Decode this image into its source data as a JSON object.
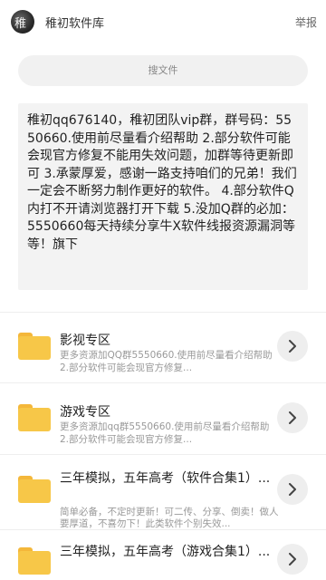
{
  "header": {
    "logo_glyph": "稚",
    "title": "稚初软件库",
    "report_label": "举报"
  },
  "search": {
    "placeholder": "搜文件"
  },
  "notice": {
    "text": "稚初qq676140，稚初团队vip群，群号码：5550660.使用前尽量看介绍帮助 2.部分软件可能会现官方修复不能用失效问题，加群等待更新即可 3.承蒙厚爱，感谢一路支持咱们的兄弟！我们一定会不断努力制作更好的软件。 4.部分软件Q内打不开请浏览器打开下载 5.没加Q群的必加：5550660每天持续分享牛X软件线报资源漏洞等等！旗下"
  },
  "folders": [
    {
      "title": "影视专区",
      "desc": "更多资源加QQ群5550660.使用前尽量看介绍帮助 2.部分软件可能会现官方修复..."
    },
    {
      "title": "游戏专区",
      "desc": "更多资源加qq群5550660.使用前尽量看介绍帮助 2.部分软件可能会现官方修复..."
    },
    {
      "title": "三年模拟，五年高考（软件合集1）...",
      "desc": "简单必备，不定时更新！可二传、分享、倒卖！做人要厚道，不喜勿下！此类软件个别失效..."
    },
    {
      "title": "三年模拟，五年高考（游戏合集1）...",
      "desc": ""
    }
  ],
  "colors": {
    "folder": "#f7c748",
    "folder_tab": "#f4b73a",
    "notice_bg": "#f3f3f3",
    "search_bg": "#f1f1f1"
  },
  "icons": {
    "logo": "avatar-logo",
    "folder": "folder-icon",
    "chevron": "chevron-right-icon"
  }
}
